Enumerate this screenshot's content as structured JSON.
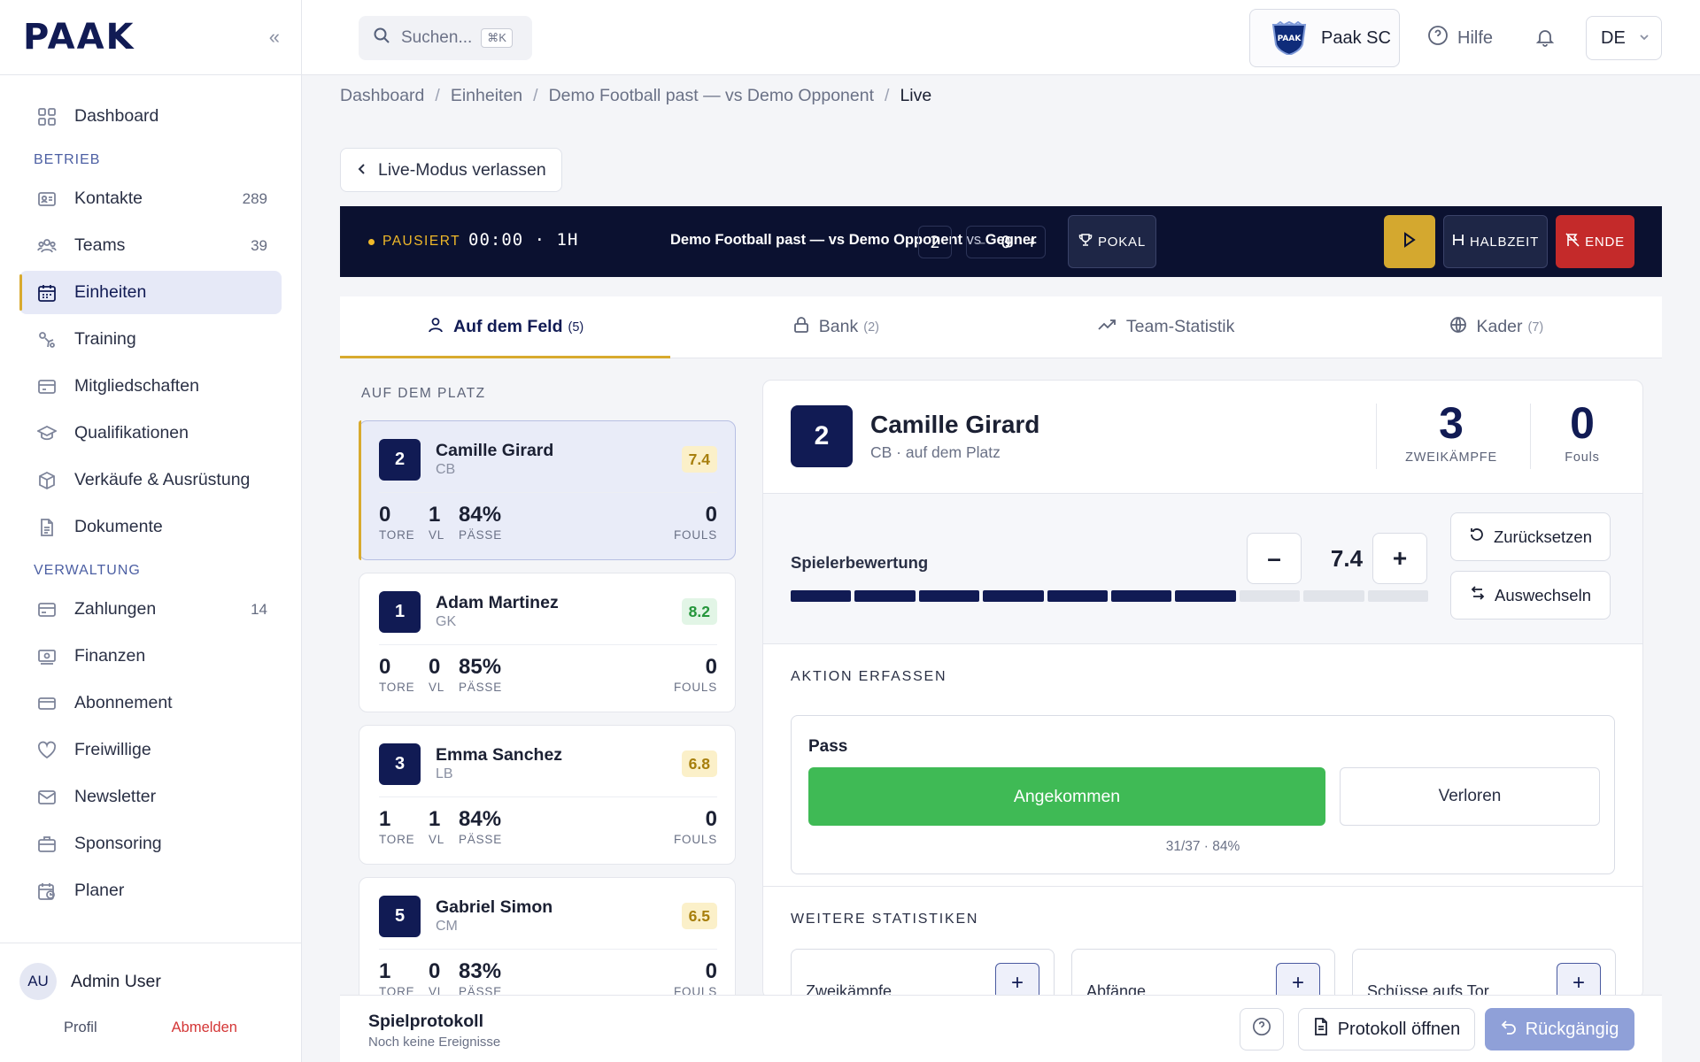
{
  "app": {
    "logo": "PAAK"
  },
  "sidebar": {
    "items_top": [
      {
        "label": "Dashboard",
        "icon": "grid-icon"
      }
    ],
    "section_betrieb": "BETRIEB",
    "betrieb": [
      {
        "label": "Kontakte",
        "count": "289",
        "icon": "contacts-icon"
      },
      {
        "label": "Teams",
        "count": "39",
        "icon": "teams-icon"
      },
      {
        "label": "Einheiten",
        "count": "",
        "icon": "calendar-icon",
        "active": true
      },
      {
        "label": "Training",
        "count": "",
        "icon": "training-icon"
      },
      {
        "label": "Mitgliedschaften",
        "count": "",
        "icon": "membership-icon"
      },
      {
        "label": "Qualifikationen",
        "count": "",
        "icon": "graduation-icon"
      },
      {
        "label": "Verkäufe & Ausrüstung",
        "count": "",
        "icon": "package-icon"
      },
      {
        "label": "Dokumente",
        "count": "",
        "icon": "document-icon"
      }
    ],
    "section_verwaltung": "VERWALTUNG",
    "verwaltung": [
      {
        "label": "Zahlungen",
        "count": "14",
        "icon": "credit-card-icon"
      },
      {
        "label": "Finanzen",
        "count": "",
        "icon": "money-icon"
      },
      {
        "label": "Abonnement",
        "count": "",
        "icon": "subscription-icon"
      },
      {
        "label": "Freiwillige",
        "count": "",
        "icon": "heart-icon"
      },
      {
        "label": "Newsletter",
        "count": "",
        "icon": "mail-icon"
      },
      {
        "label": "Sponsoring",
        "count": "",
        "icon": "briefcase-icon"
      },
      {
        "label": "Planer",
        "count": "",
        "icon": "planner-icon"
      }
    ],
    "user": {
      "initials": "AU",
      "name": "Admin User",
      "profile_label": "Profil",
      "logout_label": "Abmelden"
    }
  },
  "header": {
    "search_placeholder": "Suchen...",
    "search_shortcut": "⌘K",
    "club_name": "Paak SC",
    "club_crest_text": "PAAK",
    "help_label": "Hilfe",
    "language": "DE"
  },
  "breadcrumb": [
    "Dashboard",
    "Einheiten",
    "Demo Football past — vs Demo Opponent",
    "Live"
  ],
  "leave_label": "Live-Modus verlassen",
  "livebar": {
    "status": "PAUSIERT",
    "clock": "00:00",
    "half": "1H",
    "match_title": "Demo Football past — vs Demo Opponent",
    "vs_text": "vs",
    "opponent": "Gegner",
    "home_score": "2",
    "away_score": "0",
    "minus": "–",
    "plus": "+",
    "cup_label": "POKAL",
    "halftime_label": "HALBZEIT",
    "end_label": "ENDE"
  },
  "tabs": [
    {
      "label": "Auf dem Feld",
      "count": "(5)",
      "icon": "user-icon",
      "active": true
    },
    {
      "label": "Bank",
      "count": "(2)",
      "icon": "lock-icon"
    },
    {
      "label": "Team-Statistik",
      "count": "",
      "icon": "trend-icon"
    },
    {
      "label": "Kader",
      "count": "(7)",
      "icon": "globe-icon"
    }
  ],
  "field_label": "AUF DEM PLATZ",
  "stat_labels": {
    "goals": "TORE",
    "assists": "VL",
    "passes": "PÄSSE",
    "fouls": "FOULS"
  },
  "players": [
    {
      "num": "2",
      "name": "Camille Girard",
      "pos": "CB",
      "rating": "7.4",
      "rating_color": "gold",
      "goals": "0",
      "assists": "1",
      "passes": "84%",
      "fouls": "0",
      "selected": true
    },
    {
      "num": "1",
      "name": "Adam Martinez",
      "pos": "GK",
      "rating": "8.2",
      "rating_color": "green",
      "goals": "0",
      "assists": "0",
      "passes": "85%",
      "fouls": "0"
    },
    {
      "num": "3",
      "name": "Emma Sanchez",
      "pos": "LB",
      "rating": "6.8",
      "rating_color": "gold",
      "goals": "1",
      "assists": "1",
      "passes": "84%",
      "fouls": "0"
    },
    {
      "num": "5",
      "name": "Gabriel Simon",
      "pos": "CM",
      "rating": "6.5",
      "rating_color": "gold",
      "goals": "1",
      "assists": "0",
      "passes": "83%",
      "fouls": "0"
    }
  ],
  "detail": {
    "num": "2",
    "name": "Camille Girard",
    "sub": "CB · auf dem Platz",
    "duels_value": "3",
    "duels_label": "ZWEIKÄMPFE",
    "fouls_value": "0",
    "fouls_label": "Fouls",
    "rating_label": "Spielerbewertung",
    "rating_value": "7.4",
    "rating_segments_total": 10,
    "rating_segments_filled": 7,
    "minus": "–",
    "plus": "+",
    "reset_label": "Zurücksetzen",
    "sub_label": "Auswechseln",
    "action_title": "AKTION ERFASSEN",
    "pass_title": "Pass",
    "pass_ok": "Angekommen",
    "pass_lost": "Verloren",
    "pass_ratio": "31/37 · 84%",
    "more_title": "WEITERE STATISTIKEN",
    "more_stats": [
      "Zweikämpfe",
      "Abfänge",
      "Schüsse aufs Tor"
    ]
  },
  "bottombar": {
    "title": "Spielprotokoll",
    "subtitle": "Noch keine Ereignisse",
    "open_label": "Protokoll öffnen",
    "undo_label": "Rückgängig"
  }
}
